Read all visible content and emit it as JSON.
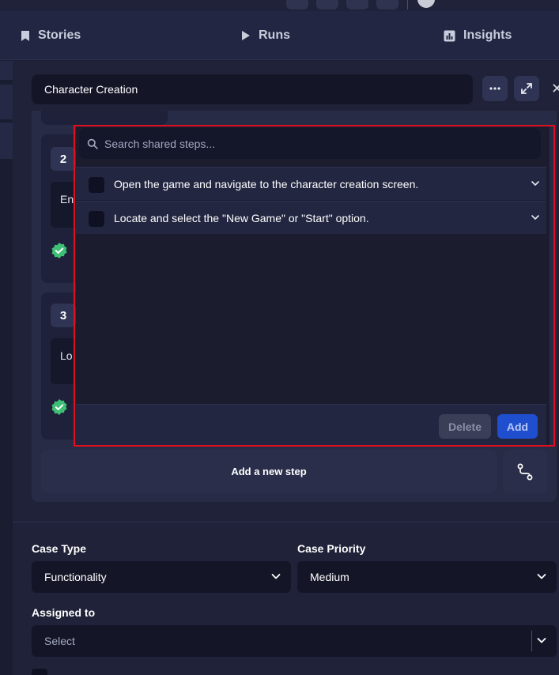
{
  "nav": {
    "stories_label": "Stories",
    "runs_label": "Runs",
    "insights_label": "Insights"
  },
  "case": {
    "title_value": "Character Creation"
  },
  "steps": [
    {
      "number": "2",
      "text_preview": "En"
    },
    {
      "number": "3",
      "text_preview": "Lo"
    }
  ],
  "add_step_label": "Add a new step",
  "shared_steps_popup": {
    "search_placeholder": "Search shared steps...",
    "items": [
      {
        "text": "Open the game and navigate to the character creation screen."
      },
      {
        "text": "Locate and select the \"New Game\" or \"Start\" option."
      }
    ],
    "delete_label": "Delete",
    "add_label": "Add"
  },
  "form": {
    "case_type_label": "Case Type",
    "case_type_value": "Functionality",
    "case_priority_label": "Case Priority",
    "case_priority_value": "Medium",
    "assigned_to_label": "Assigned to",
    "assigned_to_placeholder": "Select"
  },
  "colors": {
    "accent_add": "#1f4fcf",
    "success_badge": "#3fbf75",
    "highlight_outline": "#e11020"
  },
  "icons": {
    "stories": "bookmark-icon",
    "runs": "play-icon",
    "insights": "bar-chart-icon",
    "more": "ellipsis-icon",
    "expand": "expand-icon",
    "close": "close-icon",
    "search": "search-icon",
    "route": "route-icon",
    "chevron": "chevron-down-icon",
    "verified": "check-badge-icon"
  }
}
